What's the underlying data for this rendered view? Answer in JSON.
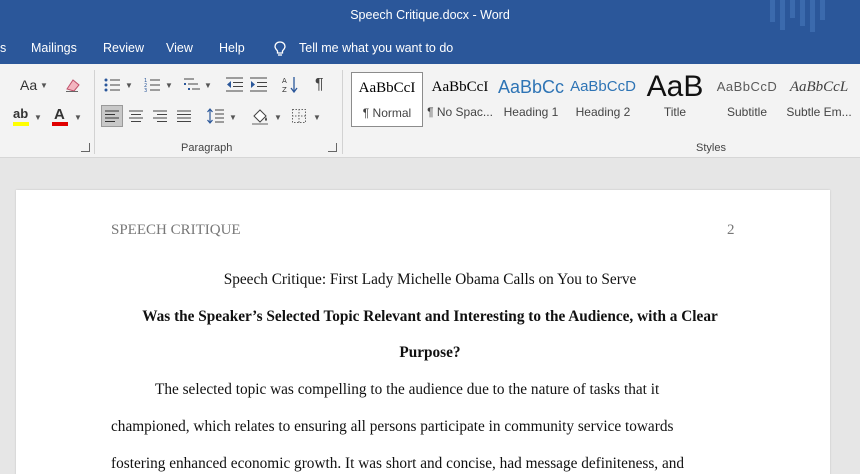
{
  "window": {
    "title": "Speech Critique.docx  -  Word"
  },
  "menu": {
    "tabs": [
      {
        "label": "s"
      },
      {
        "label": "Mailings"
      },
      {
        "label": "Review"
      },
      {
        "label": "View"
      },
      {
        "label": "Help"
      }
    ],
    "tell_me": "Tell me what you want to do"
  },
  "ribbon": {
    "font_group": {
      "change_case": "Aa"
    },
    "paragraph_group": {
      "label": "Paragraph"
    },
    "styles_group": {
      "label": "Styles",
      "styles": [
        {
          "preview": "AaBbCcI",
          "label": "¶ Normal"
        },
        {
          "preview": "AaBbCcI",
          "label": "¶ No Spac..."
        },
        {
          "preview": "AaBbCc",
          "label": "Heading 1"
        },
        {
          "preview": "AaBbCcD",
          "label": "Heading 2"
        },
        {
          "preview": "AaB",
          "label": "Title"
        },
        {
          "preview": "AaBbCcD",
          "label": "Subtitle"
        },
        {
          "preview": "AaBbCcL",
          "label": "Subtle Em..."
        }
      ]
    },
    "colors": {
      "highlight": "#ffff00",
      "font_color": "#e00000",
      "accent": "#2b579a"
    }
  },
  "document": {
    "header_left": "SPEECH CRITIQUE",
    "header_page": "2",
    "title": "Speech Critique: First Lady Michelle Obama Calls on You to Serve",
    "heading_line1": "Was the Speaker’s Selected Topic Relevant and Interesting to the Audience, with a Clear",
    "heading_line2": "Purpose?",
    "body_lines": [
      "The selected topic was compelling to the audience due to the nature of tasks that it",
      "championed, which relates to ensuring all persons participate in community service towards",
      "fostering enhanced economic growth. It was short and concise, had message definiteness, and"
    ]
  }
}
